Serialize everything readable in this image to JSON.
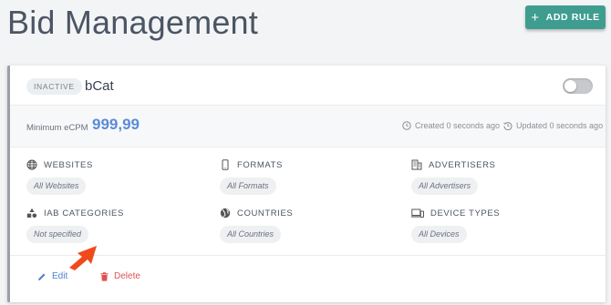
{
  "header": {
    "title": "Bid Management",
    "add_rule_label": "ADD RULE"
  },
  "rule": {
    "status": "INACTIVE",
    "name": "bCat",
    "enabled": false,
    "min_ecpm_label": "Minimum eCPM",
    "min_ecpm_value": "999,99",
    "created": "Created 0 seconds ago",
    "updated": "Updated 0 seconds ago"
  },
  "filters": {
    "websites": {
      "label": "WEBSITES",
      "value": "All Websites"
    },
    "formats": {
      "label": "FORMATS",
      "value": "All Formats"
    },
    "advertisers": {
      "label": "ADVERTISERS",
      "value": "All Advertisers"
    },
    "iab_categories": {
      "label": "IAB CATEGORIES",
      "value": "Not specified"
    },
    "countries": {
      "label": "COUNTRIES",
      "value": "All Countries"
    },
    "device_types": {
      "label": "DEVICE TYPES",
      "value": "All Devices"
    }
  },
  "actions": {
    "edit": "Edit",
    "delete": "Delete"
  },
  "colors": {
    "accent": "#3f9d8f",
    "ecpm": "#5b8bd6",
    "edit": "#4a7fd1",
    "delete": "#e05252",
    "annotation_arrow": "#f04a1c"
  }
}
